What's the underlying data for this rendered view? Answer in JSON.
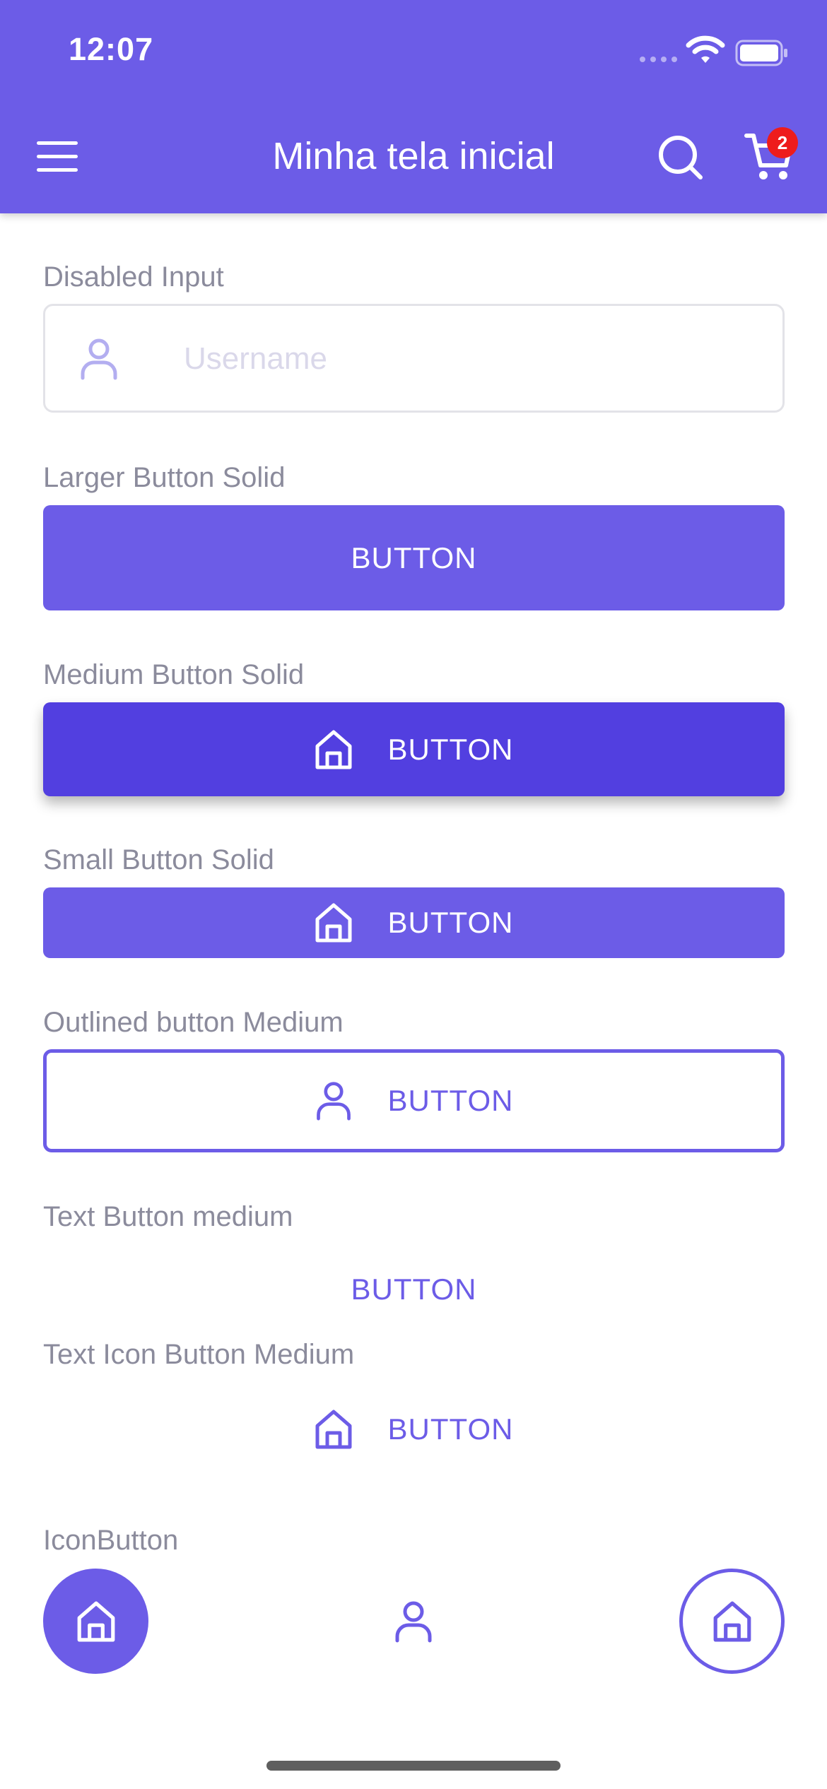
{
  "status_bar": {
    "time": "12:07"
  },
  "header": {
    "title": "Minha tela inicial",
    "cart_count": "2",
    "menu_icon": "hamburger-menu-icon",
    "search_icon": "search-icon",
    "cart_icon": "shopping-cart-icon"
  },
  "sections": {
    "disabled_input": {
      "label": "Disabled Input",
      "placeholder": "Username",
      "icon": "user-icon"
    },
    "large_solid": {
      "label": "Larger Button Solid",
      "button": "BUTTON"
    },
    "medium_solid": {
      "label": "Medium Button Solid",
      "button": "BUTTON",
      "icon": "home-icon"
    },
    "small_solid": {
      "label": "Small Button Solid",
      "button": "BUTTON",
      "icon": "home-icon"
    },
    "outlined_medium": {
      "label": "Outlined button Medium",
      "button": "BUTTON",
      "icon": "user-icon"
    },
    "text_medium": {
      "label": "Text Button medium",
      "button": "BUTTON"
    },
    "text_icon_medium": {
      "label": "Text Icon Button Medium",
      "button": "BUTTON",
      "icon": "home-icon"
    },
    "icon_button": {
      "label": "IconButton",
      "icons": [
        "home-icon",
        "user-icon",
        "home-icon"
      ]
    }
  },
  "colors": {
    "primary": "#6c5ce7",
    "primary_dark": "#523fe0",
    "label": "#8b8b9c",
    "badge": "#ee1c1c"
  }
}
